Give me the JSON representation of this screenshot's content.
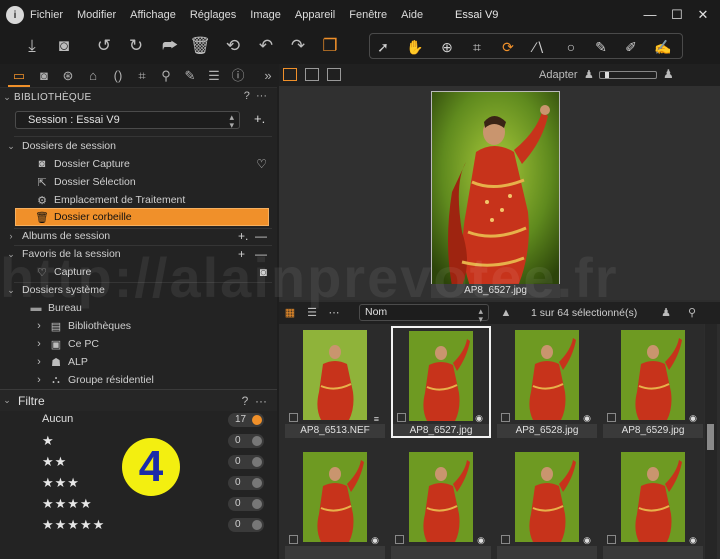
{
  "app": {
    "title": "Essai V9",
    "menu": [
      "Fichier",
      "Modifier",
      "Affichage",
      "Réglages",
      "Image",
      "Appareil",
      "Fenêtre",
      "Aide"
    ],
    "accent": "#f0902a"
  },
  "library": {
    "header": "BIBLIOTHÈQUE",
    "help": "?",
    "more": "···",
    "session_value": "Session : Essai V9",
    "session_folders_title": "Dossiers de session",
    "session_folders": [
      {
        "label": "Dossier Capture",
        "icon": "camera-icon",
        "right_icon": "heart-icon"
      },
      {
        "label": "Dossier Sélection",
        "icon": "selection-icon"
      },
      {
        "label": "Emplacement de Traitement",
        "icon": "gear-icon"
      },
      {
        "label": "Dossier corbeille",
        "icon": "trash-icon",
        "selected": true
      }
    ],
    "albums_title": "Albums de session",
    "favorites_title": "Favoris de la session",
    "favorites": [
      {
        "label": "Capture",
        "icon": "heart-icon",
        "right_icon": "camera-icon"
      }
    ],
    "system_title": "Dossiers système",
    "system": [
      {
        "label": "Bureau",
        "icon": "desktop-icon"
      },
      {
        "label": "Bibliothèques",
        "icon": "library-icon"
      },
      {
        "label": "Ce PC",
        "icon": "pc-icon"
      },
      {
        "label": "ALP",
        "icon": "user-folder-icon"
      },
      {
        "label": "Groupe résidentiel",
        "icon": "homegroup-icon"
      }
    ]
  },
  "filter": {
    "title": "Filtre",
    "help": "?",
    "more": "···",
    "rows": [
      {
        "label": "Aucun",
        "stars": "",
        "count": "17",
        "active": true
      },
      {
        "label": "",
        "stars": "★",
        "count": "0"
      },
      {
        "label": "",
        "stars": "★★",
        "count": "0"
      },
      {
        "label": "",
        "stars": "★★★",
        "count": "0"
      },
      {
        "label": "",
        "stars": "★★★★",
        "count": "0"
      },
      {
        "label": "",
        "stars": "★★★★★",
        "count": "0"
      }
    ]
  },
  "callout": "4",
  "viewer": {
    "zoom_label": "Adapter",
    "main_caption": "AP8_6527.jpg"
  },
  "browser": {
    "sort_value": "Nom",
    "selection_count": "1 sur 64 sélectionné(s)",
    "thumbnails": [
      {
        "caption": "AP8_6513.NEF",
        "badge": "≡"
      },
      {
        "caption": "AP8_6527.jpg",
        "badge": "◉",
        "selected": true
      },
      {
        "caption": "AP8_6528.jpg",
        "badge": "◉"
      },
      {
        "caption": "AP8_6529.jpg",
        "badge": "◉"
      },
      {
        "caption": "",
        "badge": "◉"
      },
      {
        "caption": "",
        "badge": "◉"
      },
      {
        "caption": "",
        "badge": "◉"
      },
      {
        "caption": "",
        "badge": "◉"
      }
    ]
  },
  "watermark": "http://alainprevotee.fr"
}
